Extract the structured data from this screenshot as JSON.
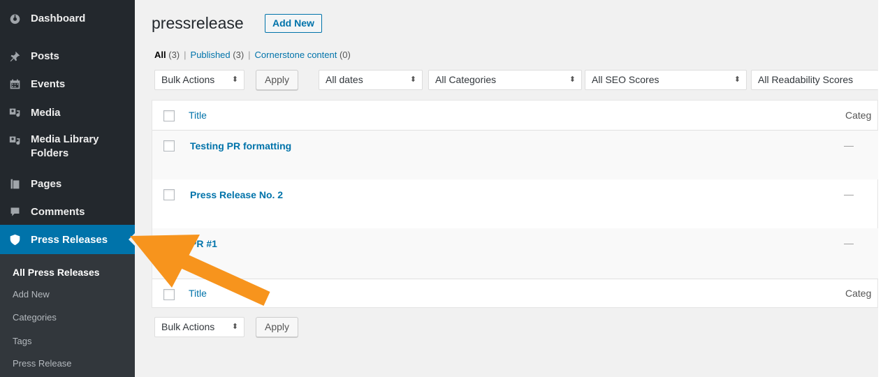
{
  "sidebar": {
    "items": [
      {
        "label": "Dashboard",
        "icon": "dashboard-icon"
      },
      {
        "label": "Posts",
        "icon": "pin-icon"
      },
      {
        "label": "Events",
        "icon": "calendar-icon"
      },
      {
        "label": "Media",
        "icon": "media-icon"
      },
      {
        "label": "Media Library",
        "label2": "Folders",
        "icon": "media-icon"
      },
      {
        "label": "Pages",
        "icon": "pages-icon"
      },
      {
        "label": "Comments",
        "icon": "comment-icon"
      },
      {
        "label": "Press Releases",
        "icon": "shield-icon",
        "active": true
      }
    ],
    "submenu": [
      {
        "label": "All Press Releases",
        "current": true
      },
      {
        "label": "Add New"
      },
      {
        "label": "Categories"
      },
      {
        "label": "Tags"
      },
      {
        "label": "Press Release"
      }
    ]
  },
  "header": {
    "title": "pressrelease",
    "add_new_label": "Add New"
  },
  "views": {
    "all_label": "All",
    "all_count": "(3)",
    "published_label": "Published",
    "published_count": "(3)",
    "cornerstone_label": "Cornerstone content",
    "cornerstone_count": "(0)",
    "separator": "|"
  },
  "filters": {
    "bulk_actions": "Bulk Actions",
    "apply": "Apply",
    "dates": "All dates",
    "categories": "All Categories",
    "seo": "All SEO Scores",
    "readability": "All Readability Scores",
    "arrow": "⬍"
  },
  "table": {
    "col_title": "Title",
    "col_categories": "Categ",
    "rows": [
      {
        "title": "Testing PR formatting",
        "categories": "—"
      },
      {
        "title": "Press Release No. 2",
        "categories": "—"
      },
      {
        "title": "PR #1",
        "categories": "—"
      }
    ]
  },
  "bottom": {
    "bulk_actions": "Bulk Actions",
    "apply": "Apply"
  },
  "colors": {
    "sidebar_bg": "#23282d",
    "active_bg": "#0073aa",
    "link": "#0073aa",
    "annotation_arrow": "#f7941d"
  }
}
